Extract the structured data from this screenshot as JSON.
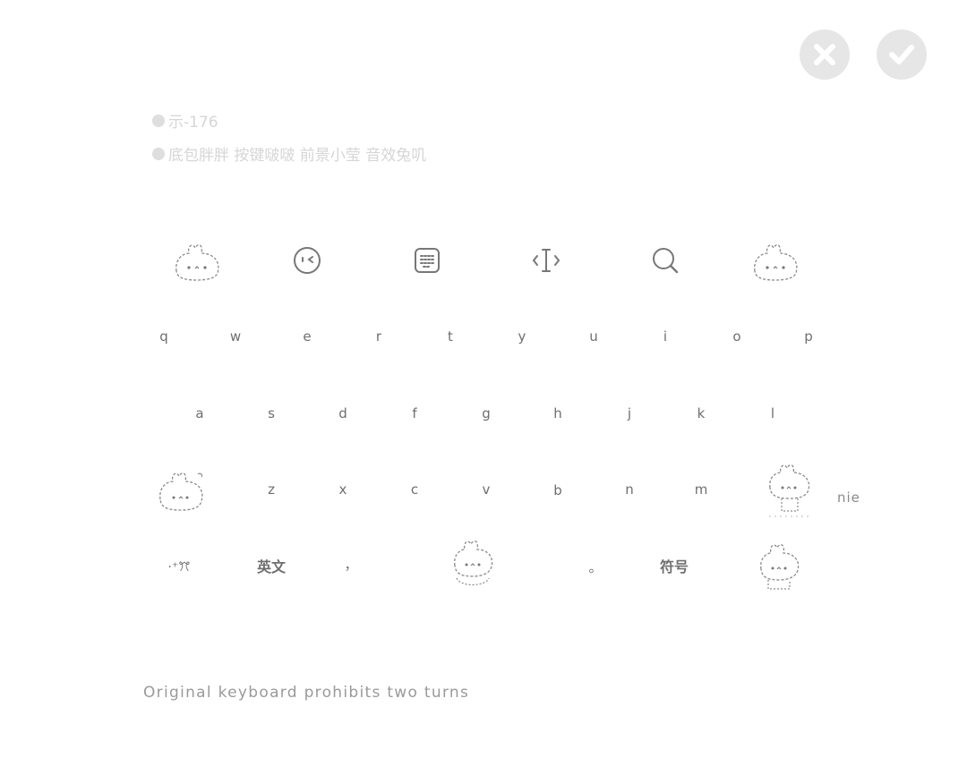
{
  "header": {
    "cancel_icon": "close-icon",
    "confirm_icon": "check-icon"
  },
  "info": {
    "line1": "示-176",
    "line2": "底包胖胖  按键啵啵  前景小莹  音效兔叽"
  },
  "toolbar": {
    "items": [
      "bunny-icon",
      "emoji-icon",
      "keyboard-icon",
      "cursor-icon",
      "search-icon",
      "bunny-icon"
    ]
  },
  "keyboard": {
    "row1": [
      "q",
      "w",
      "e",
      "r",
      "t",
      "y",
      "u",
      "i",
      "o",
      "p"
    ],
    "row2": [
      "a",
      "s",
      "d",
      "f",
      "g",
      "h",
      "j",
      "k",
      "l"
    ],
    "row3": [
      "z",
      "x",
      "c",
      "v",
      "b",
      "n",
      "m"
    ],
    "bottom": {
      "symbol_key": "·⁺ꔫ",
      "lang_key": "英文",
      "comma_key": "，",
      "period_key": "。",
      "symbols_key": "符号"
    },
    "candidate": "nie"
  },
  "footer": {
    "note": "Original keyboard prohibits two turns"
  }
}
